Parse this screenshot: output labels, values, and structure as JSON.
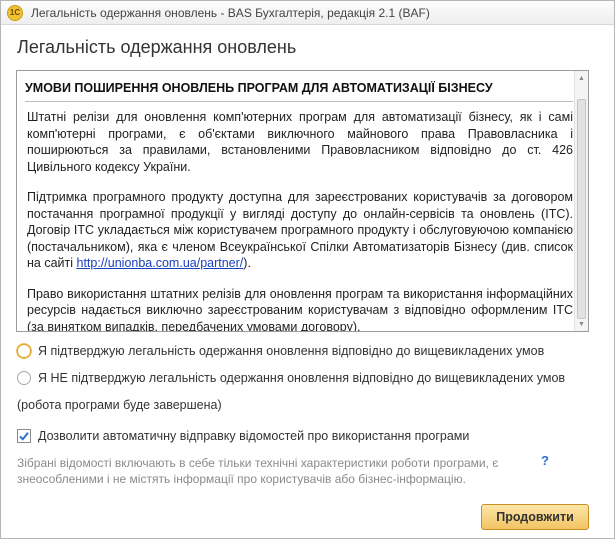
{
  "window": {
    "title": "Легальність одержання оновлень - BAS Бухгалтерія, редакція 2.1  (BAF)",
    "app_icon": "1c-app-icon",
    "app_icon_text": "1С"
  },
  "heading": "Легальність одержання оновлень",
  "terms": {
    "header": "УМОВИ ПОШИРЕННЯ ОНОВЛЕНЬ ПРОГРАМ ДЛЯ АВТОМАТИЗАЦІЇ БІЗНЕСУ",
    "paragraph1": "Штатні релізи для оновлення комп'ютерних програм для автоматизації бізнесу, як і самі комп'ютерні програми, є об'єктами виключного майнового права Правовласника і поширюються за правилами, встановленими Правовласником відповідно до ст. 426 Цивільного кодексу України.",
    "paragraph2_before_link": "Підтримка програмного продукту доступна для зареєстрованих користувачів за договором постачання програмної продукції у вигляді доступу до онлайн-сервісів та оновлень (ІТС). Договір ІТС укладається між користувачем програмного продукту і обслуговуючою компанією (постачальником), яка є членом Всеукраїнської Спілки Автоматизаторів Бізнесу (див. список на сайті ",
    "paragraph2_link": "http://unionba.com.ua/partner/",
    "paragraph2_after_link": ").",
    "paragraph3": "Право використання штатних релізів для оновлення програм та використання інформаційних ресурсів надається виключно зареєстрованим користувачам з відповідно оформленим ІТС (за винятком випадків, передбачених умовами договору)."
  },
  "options": {
    "confirm_label": "Я підтверджую легальність одержання оновлення відповідно до вищевикладених умов",
    "deny_label": "Я НЕ підтверджую легальність одержання оновлення відповідно до вищевикладених умов",
    "deny_note": "(робота програми буде завершена)",
    "selected": "none"
  },
  "telemetry": {
    "label": "Дозволити автоматичну відправку відомостей про використання програми",
    "checked": true,
    "info": "Зібрані відомості включають в себе тільки технічні характеристики роботи програми, є знеособленими і не містять інформації про користувачів або бізнес-інформацію.",
    "help_icon": "?"
  },
  "buttons": {
    "continue_label": "Продовжити"
  },
  "colors": {
    "accent_button": "#f2c463",
    "link": "#1a3fbf",
    "info_text": "#8a8a8a",
    "help_icon": "#2f6fd6"
  }
}
